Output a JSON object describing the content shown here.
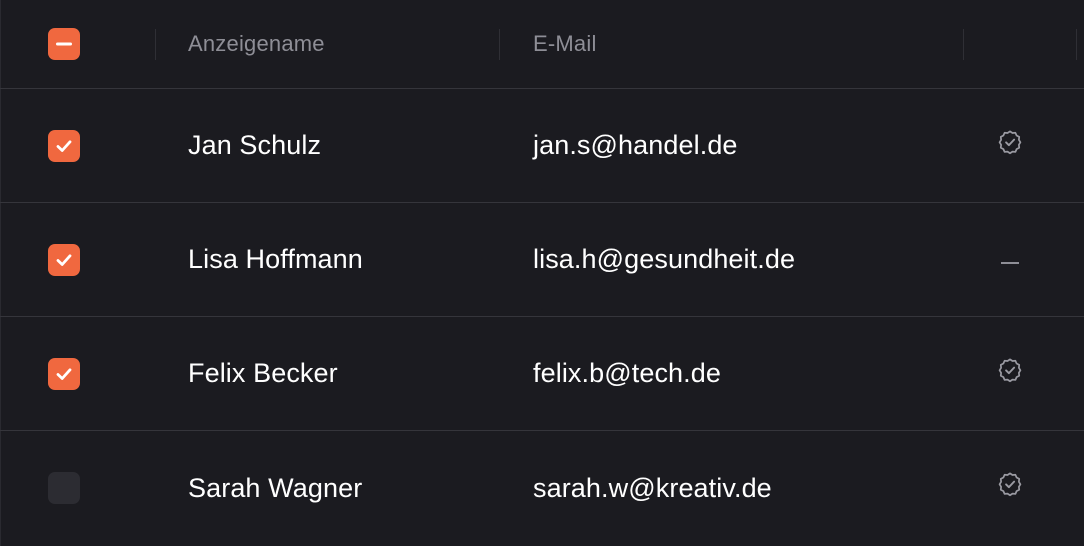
{
  "header": {
    "select_all_state": "indeterminate",
    "columns": {
      "name": "Anzeigename",
      "email": "E-Mail"
    }
  },
  "colors": {
    "accent": "#f0683f",
    "background": "#1b1b20",
    "divider": "#35353b",
    "header_text": "#8e8e96",
    "unchecked_box": "#2c2c32"
  },
  "rows": [
    {
      "checked": true,
      "name": "Jan Schulz",
      "email": "jan.s@handel.de",
      "status_icon": "verified-badge-icon"
    },
    {
      "checked": true,
      "name": "Lisa Hoffmann",
      "email": "lisa.h@gesundheit.de",
      "status_icon": "dash-icon"
    },
    {
      "checked": true,
      "name": "Felix Becker",
      "email": "felix.b@tech.de",
      "status_icon": "verified-badge-icon"
    },
    {
      "checked": false,
      "name": "Sarah Wagner",
      "email": "sarah.w@kreativ.de",
      "status_icon": "verified-badge-icon"
    }
  ]
}
